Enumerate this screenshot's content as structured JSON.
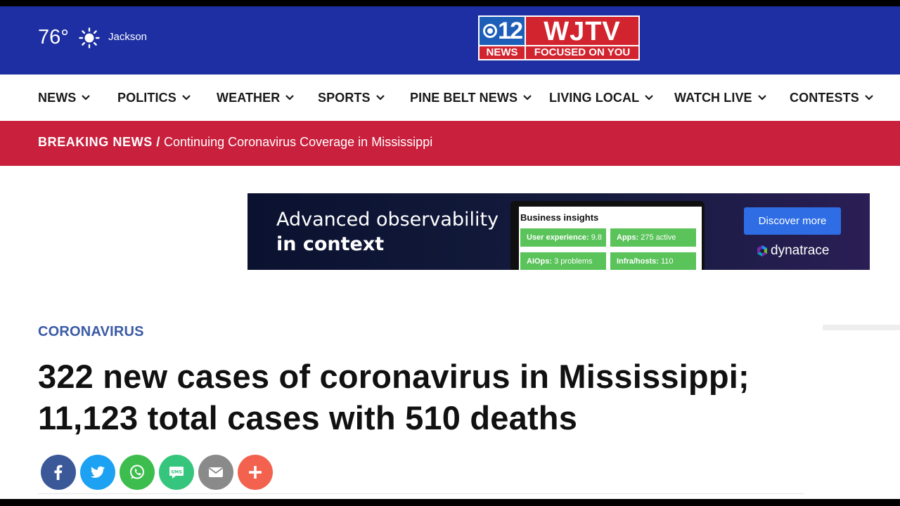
{
  "header": {
    "temperature": "76°",
    "weather_icon": "sun-icon",
    "city": "Jackson",
    "logo": {
      "channel": "12",
      "callsign": "WJTV",
      "news": "NEWS",
      "tagline": "FOCUSED ON YOU"
    }
  },
  "nav": {
    "items": [
      {
        "label": "NEWS"
      },
      {
        "label": "POLITICS"
      },
      {
        "label": "WEATHER"
      },
      {
        "label": "SPORTS"
      },
      {
        "label": "PINE BELT NEWS"
      },
      {
        "label": "LIVING LOCAL"
      },
      {
        "label": "WATCH LIVE"
      },
      {
        "label": "CONTESTS"
      }
    ]
  },
  "breaking": {
    "label": "BREAKING NEWS /",
    "text": "Continuing Coronavirus Coverage in Mississippi"
  },
  "ad": {
    "line1": "Advanced observability",
    "line2": "in context",
    "panel_title": "Business insights",
    "tiles": [
      {
        "label": "User experience:",
        "value": "9.8"
      },
      {
        "label": "Apps:",
        "value": "275 active"
      },
      {
        "label": "AIOps:",
        "value": "3 problems"
      },
      {
        "label": "Infra/hosts:",
        "value": "110"
      }
    ],
    "button": "Discover more",
    "brand": "dynatrace"
  },
  "article": {
    "category": "CORONAVIRUS",
    "headline_line1": "322 new cases of coronavirus in Mississippi;",
    "headline_line2": "11,123 total cases with 510 deaths"
  },
  "share": [
    {
      "name": "facebook-share-button",
      "icon": "facebook-icon",
      "color": "#3b5998"
    },
    {
      "name": "twitter-share-button",
      "icon": "twitter-icon",
      "color": "#1da1f2"
    },
    {
      "name": "whatsapp-share-button",
      "icon": "whatsapp-icon",
      "color": "#3dbd4e"
    },
    {
      "name": "sms-share-button",
      "icon": "sms-icon",
      "color": "#36c57c"
    },
    {
      "name": "email-share-button",
      "icon": "email-icon",
      "color": "#8a8a8a"
    },
    {
      "name": "more-share-button",
      "icon": "plus-icon",
      "color": "#f2624f"
    }
  ]
}
